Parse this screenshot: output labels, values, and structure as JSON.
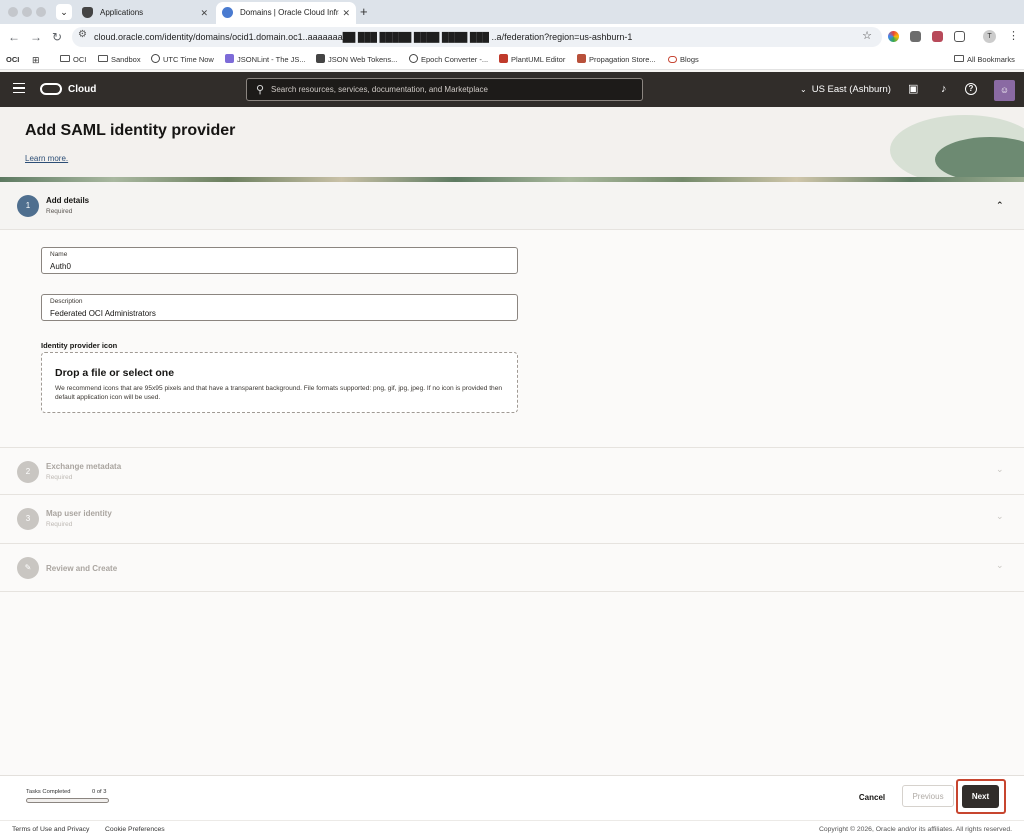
{
  "browser": {
    "tabs": [
      {
        "title": "Applications",
        "favicon": "shield-icon"
      },
      {
        "title": "Domains | Oracle Cloud Infras",
        "favicon": "cloud-icon"
      }
    ],
    "url": "cloud.oracle.com/identity/domains/ocid1.domain.oc1..aaaaaaa██  ███ █████  ████  ████ ███ ..a/federation?region=us-ashburn-1",
    "bookmarks": [
      {
        "label": "OCI",
        "icon": "oci-badge-icon"
      },
      {
        "label": "OCI",
        "icon": "folder-icon"
      },
      {
        "label": "Sandbox",
        "icon": "folder-icon"
      },
      {
        "label": "UTC Time Now",
        "icon": "clock-icon"
      },
      {
        "label": "JSONLint - The JS...",
        "icon": "jsonlint-icon"
      },
      {
        "label": "JSON Web Tokens...",
        "icon": "jwt-icon"
      },
      {
        "label": "Epoch Converter -...",
        "icon": "clock-icon"
      },
      {
        "label": "PlantUML Editor",
        "icon": "plantuml-icon"
      },
      {
        "label": "Propagation Store...",
        "icon": "p-icon"
      },
      {
        "label": "Blogs",
        "icon": "oracle-icon"
      }
    ],
    "all_bookmarks": "All Bookmarks",
    "profile_initial": "T"
  },
  "header": {
    "brand": "Cloud",
    "search_placeholder": "Search resources, services, documentation, and Marketplace",
    "region": "US East (Ashburn)"
  },
  "page": {
    "title": "Add SAML identity provider",
    "learn_more": "Learn more."
  },
  "steps": [
    {
      "number": "1",
      "title": "Add details",
      "subtitle": "Required",
      "state": "active"
    },
    {
      "number": "2",
      "title": "Exchange metadata",
      "subtitle": "Required",
      "state": "pending"
    },
    {
      "number": "3",
      "title": "Map user identity",
      "subtitle": "Required",
      "state": "pending"
    },
    {
      "number": "",
      "title": "Review and Create",
      "subtitle": "",
      "state": "pending"
    }
  ],
  "form": {
    "name_label": "Name",
    "name_value": "Auth0",
    "description_label": "Description",
    "description_value": "Federated OCI Administrators",
    "icon_label": "Identity provider icon",
    "dropzone_title": "Drop a file or select one",
    "dropzone_text": "We recommend icons that are 95x95 pixels and that have a transparent background. File formats supported: png, gif, jpg, jpeg. If no icon is provided then default application icon will be used."
  },
  "footer": {
    "tasks_label": "Tasks Completed",
    "tasks_count": "0 of 3",
    "tasks_progress": 0,
    "cancel": "Cancel",
    "previous": "Previous",
    "next": "Next"
  },
  "legal": {
    "terms": "Terms of Use and Privacy",
    "cookies": "Cookie Preferences",
    "copyright": "Copyright © 2026, Oracle and/or its affiliates. All rights reserved."
  },
  "colors": {
    "header_bg": "#312d2a",
    "active_step": "#4f6f8f",
    "pending_step": "#c9c6c2",
    "next_highlight": "#c7452f"
  }
}
